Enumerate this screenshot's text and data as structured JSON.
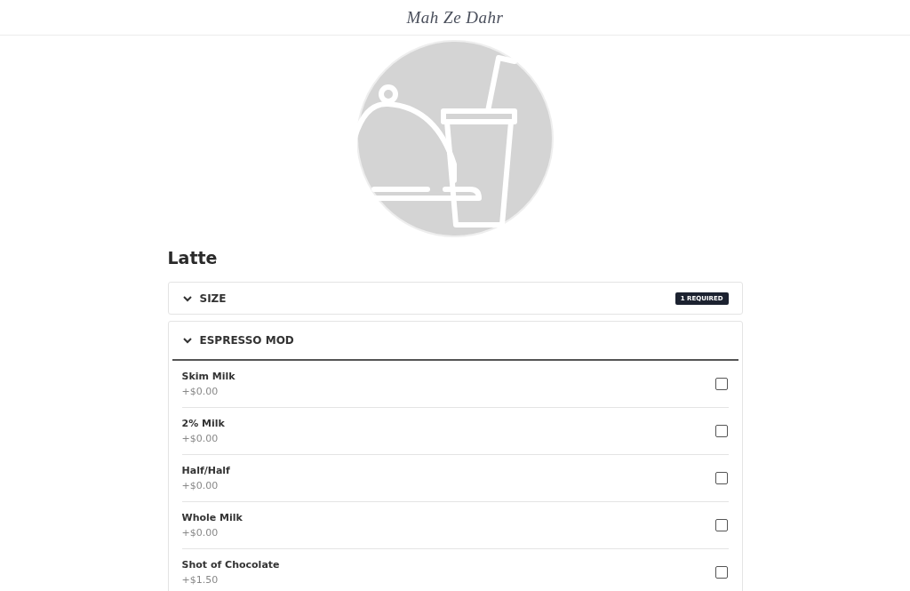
{
  "header": {
    "logo": "Mah Ze Dahr"
  },
  "item": {
    "title": "Latte"
  },
  "sections": [
    {
      "title": "SIZE",
      "badge": "1 REQUIRED",
      "expanded": false
    },
    {
      "title": "ESPRESSO MOD",
      "expanded": true,
      "options": [
        {
          "name": "Skim Milk",
          "price": "+$0.00",
          "checked": false
        },
        {
          "name": "2% Milk",
          "price": "+$0.00",
          "checked": false
        },
        {
          "name": "Half/Half",
          "price": "+$0.00",
          "checked": false
        },
        {
          "name": "Whole Milk",
          "price": "+$0.00",
          "checked": false
        },
        {
          "name": "Shot of Chocolate",
          "price": "+$1.50",
          "checked": false
        }
      ]
    }
  ]
}
